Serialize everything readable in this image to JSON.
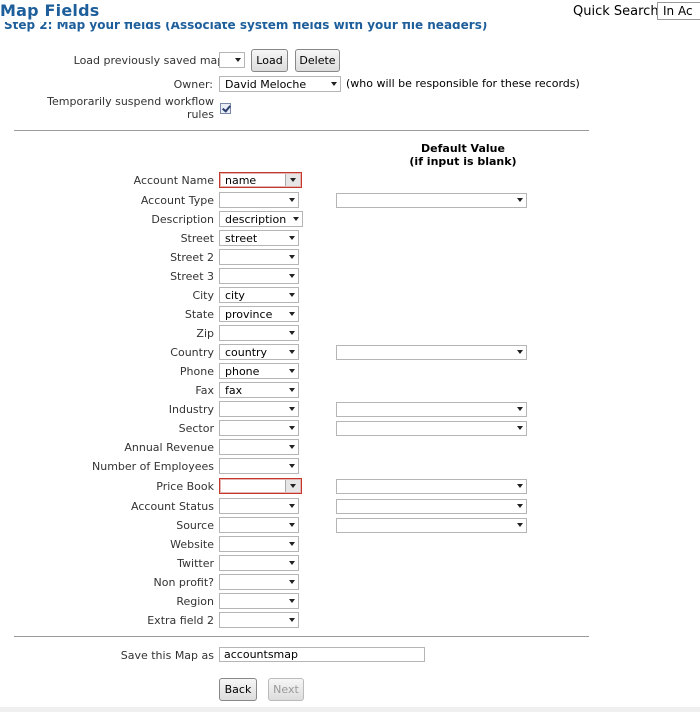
{
  "header": {
    "page_title": "Map Fields",
    "quick_search_label": "Quick Search",
    "quick_search_value": "In Ac"
  },
  "step_title": "Step 2: Map your fields (Associate system fields with your file headers)",
  "load_map": {
    "label": "Load previously saved map:",
    "selected": "",
    "load_button": "Load",
    "delete_button": "Delete"
  },
  "owner": {
    "label": "Owner:",
    "selected": "David Meloche",
    "note": "(who will be responsible for these records)"
  },
  "suspend_workflow": {
    "label_line1": "Temporarily suspend workflow",
    "label_line2": "rules",
    "checked": true
  },
  "default_value_header": {
    "line1": "Default Value",
    "line2": "(if input is blank)"
  },
  "fields": [
    {
      "label": "Account Name",
      "value": "name",
      "error": true,
      "default": false
    },
    {
      "label": "Account Type",
      "value": "",
      "error": false,
      "default": true
    },
    {
      "label": "Description",
      "value": "description",
      "error": false,
      "default": false
    },
    {
      "label": "Street",
      "value": "street",
      "error": false,
      "default": false
    },
    {
      "label": "Street 2",
      "value": "",
      "error": false,
      "default": false
    },
    {
      "label": "Street 3",
      "value": "",
      "error": false,
      "default": false
    },
    {
      "label": "City",
      "value": "city",
      "error": false,
      "default": false
    },
    {
      "label": "State",
      "value": "province",
      "error": false,
      "default": false
    },
    {
      "label": "Zip",
      "value": "",
      "error": false,
      "default": false
    },
    {
      "label": "Country",
      "value": "country",
      "error": false,
      "default": true
    },
    {
      "label": "Phone",
      "value": "phone",
      "error": false,
      "default": false
    },
    {
      "label": "Fax",
      "value": "fax",
      "error": false,
      "default": false
    },
    {
      "label": "Industry",
      "value": "",
      "error": false,
      "default": true
    },
    {
      "label": "Sector",
      "value": "",
      "error": false,
      "default": true
    },
    {
      "label": "Annual Revenue",
      "value": "",
      "error": false,
      "default": false
    },
    {
      "label": "Number of Employees",
      "value": "",
      "error": false,
      "default": false
    },
    {
      "label": "Price Book",
      "value": "",
      "error": true,
      "default": true
    },
    {
      "label": "Account Status",
      "value": "",
      "error": false,
      "default": true
    },
    {
      "label": "Source",
      "value": "",
      "error": false,
      "default": true
    },
    {
      "label": "Website",
      "value": "",
      "error": false,
      "default": false
    },
    {
      "label": "Twitter",
      "value": "",
      "error": false,
      "default": false
    },
    {
      "label": "Non profit?",
      "value": "",
      "error": false,
      "default": false
    },
    {
      "label": "Region",
      "value": "",
      "error": false,
      "default": false
    },
    {
      "label": "Extra field 2",
      "value": "",
      "error": false,
      "default": false
    }
  ],
  "save_map": {
    "label": "Save this Map as",
    "value": "accountsmap"
  },
  "nav": {
    "back_button": "Back",
    "next_button": "Next"
  }
}
